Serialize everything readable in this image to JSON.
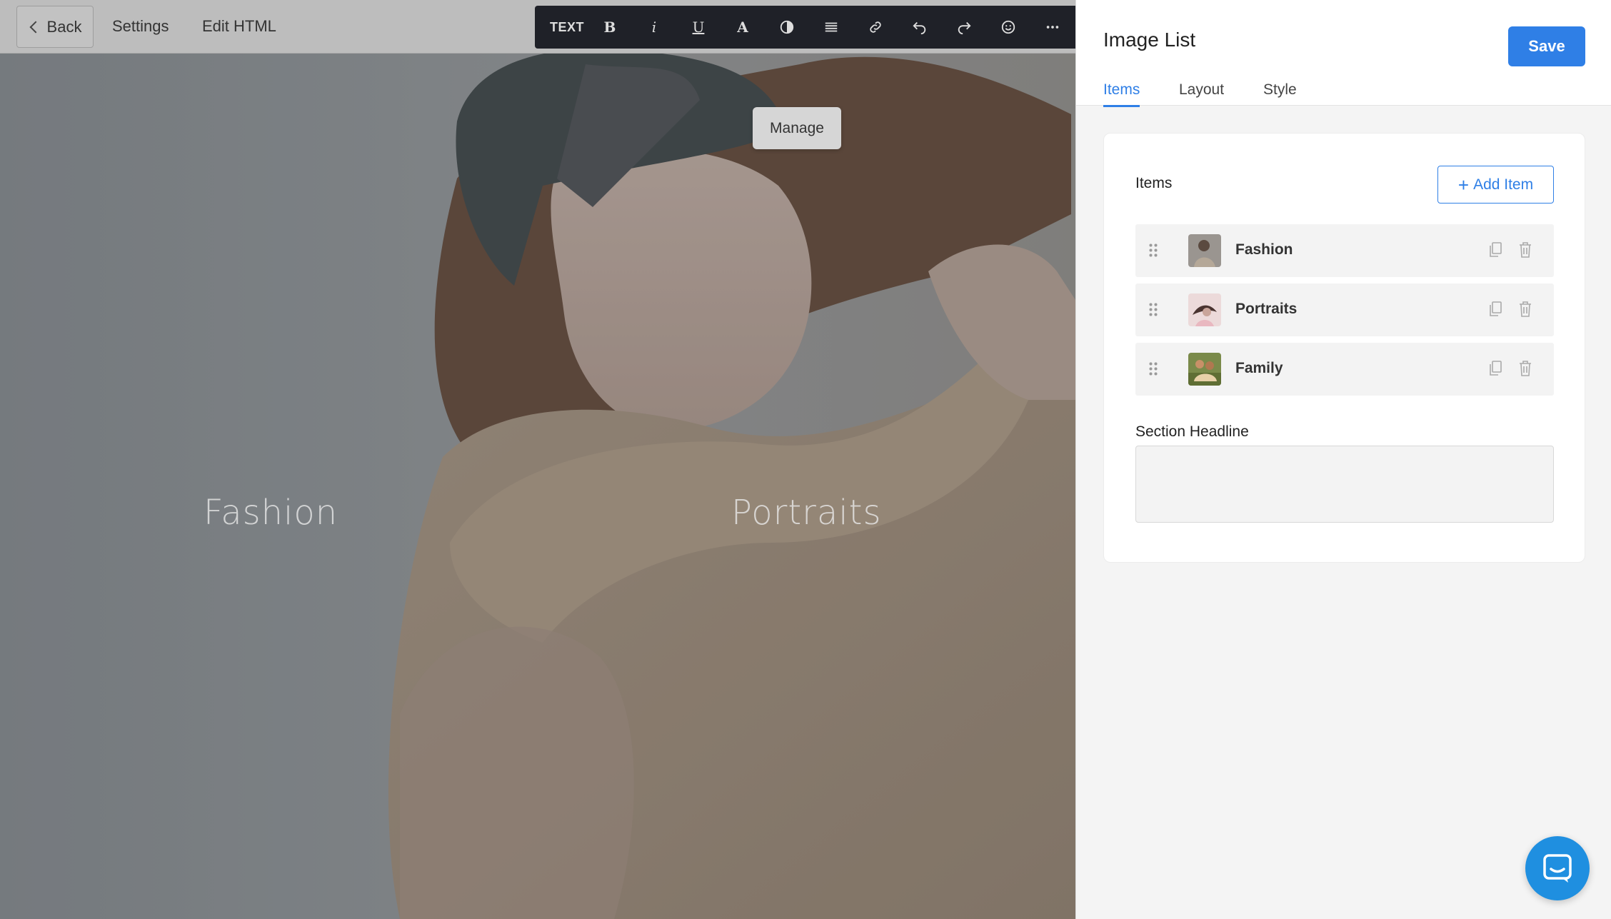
{
  "topbar": {
    "back_label": "Back",
    "settings_label": "Settings",
    "edit_html_label": "Edit HTML"
  },
  "toolbar": {
    "text_label": "TEXT",
    "bold_label": "B",
    "italic_label": "i",
    "underline_label": "U",
    "font_color_label": "A",
    "icons": [
      "contrast-icon",
      "align-icon",
      "link-icon",
      "undo-icon",
      "redo-icon",
      "emoji-icon",
      "more-icon"
    ]
  },
  "canvas": {
    "manage_label": "Manage",
    "labels": [
      "Fashion",
      "Portraits"
    ]
  },
  "panel": {
    "title": "Image List",
    "save_label": "Save",
    "tabs": [
      {
        "label": "Items",
        "active": true
      },
      {
        "label": "Layout",
        "active": false
      },
      {
        "label": "Style",
        "active": false
      }
    ],
    "items_heading": "Items",
    "add_item_label": "Add Item",
    "items": [
      {
        "name": "Fashion"
      },
      {
        "name": "Portraits"
      },
      {
        "name": "Family"
      }
    ],
    "section_headline_label": "Section Headline",
    "section_headline_value": ""
  },
  "colors": {
    "accent": "#2f7fe6",
    "toolbar_bg": "#1f2128",
    "chat_button": "#1f8fe0"
  }
}
